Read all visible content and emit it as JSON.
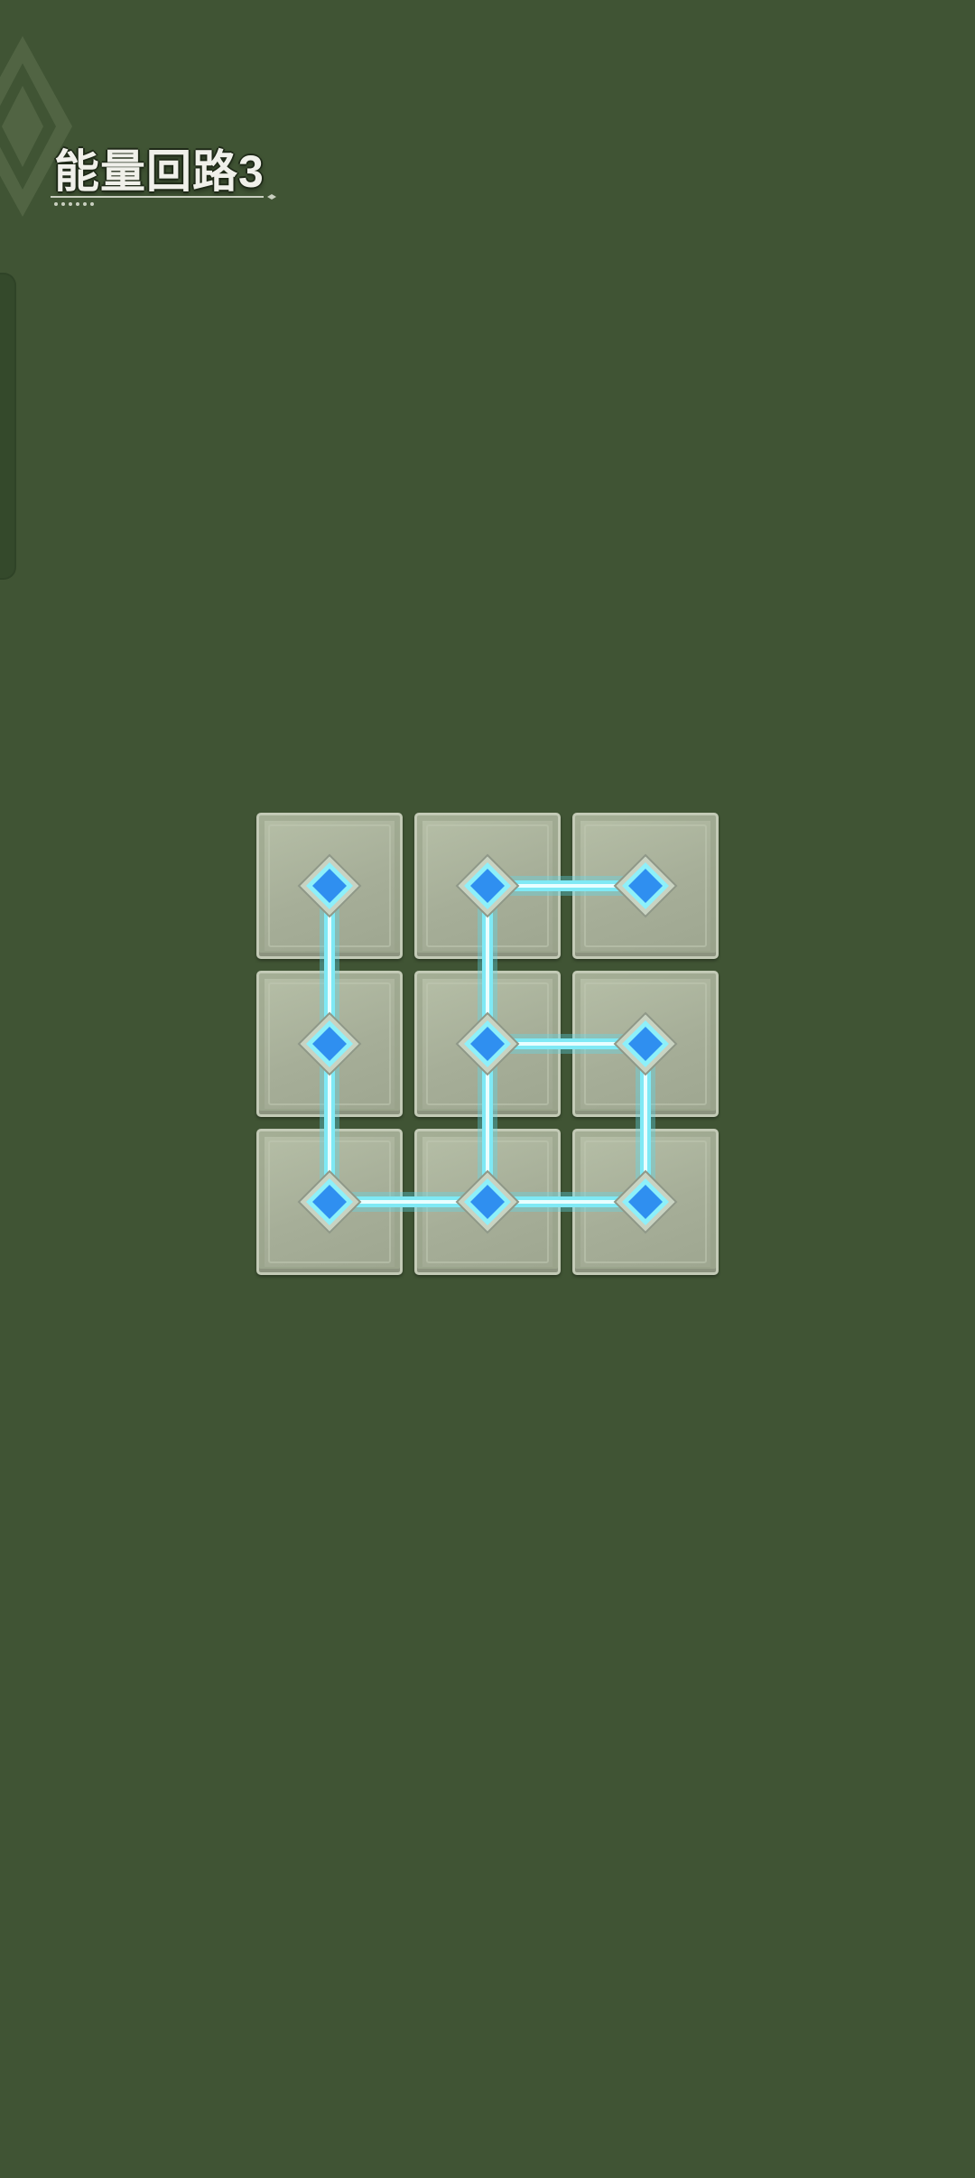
{
  "level": {
    "title": "能量回路3"
  },
  "colors": {
    "background": "#405434",
    "tile": "#a8b09a",
    "energy_line": "#7fe9f5",
    "node": "#2f8ff0"
  },
  "icons": {
    "emblem": "diamond-emblem-icon",
    "node": "energy-node-icon"
  },
  "board": {
    "rows": 3,
    "cols": 3,
    "nodes": [
      {
        "row": 0,
        "col": 0
      },
      {
        "row": 0,
        "col": 1
      },
      {
        "row": 0,
        "col": 2
      },
      {
        "row": 1,
        "col": 0
      },
      {
        "row": 1,
        "col": 1
      },
      {
        "row": 1,
        "col": 2
      },
      {
        "row": 2,
        "col": 0
      },
      {
        "row": 2,
        "col": 1
      },
      {
        "row": 2,
        "col": 2
      }
    ],
    "connections": [
      {
        "from": [
          0,
          0
        ],
        "to": [
          1,
          0
        ]
      },
      {
        "from": [
          1,
          0
        ],
        "to": [
          2,
          0
        ]
      },
      {
        "from": [
          2,
          0
        ],
        "to": [
          2,
          1
        ]
      },
      {
        "from": [
          0,
          1
        ],
        "to": [
          0,
          2
        ]
      },
      {
        "from": [
          0,
          1
        ],
        "to": [
          1,
          1
        ]
      },
      {
        "from": [
          1,
          1
        ],
        "to": [
          2,
          1
        ]
      },
      {
        "from": [
          1,
          1
        ],
        "to": [
          1,
          2
        ]
      },
      {
        "from": [
          1,
          2
        ],
        "to": [
          2,
          2
        ]
      },
      {
        "from": [
          2,
          1
        ],
        "to": [
          2,
          2
        ]
      }
    ]
  }
}
